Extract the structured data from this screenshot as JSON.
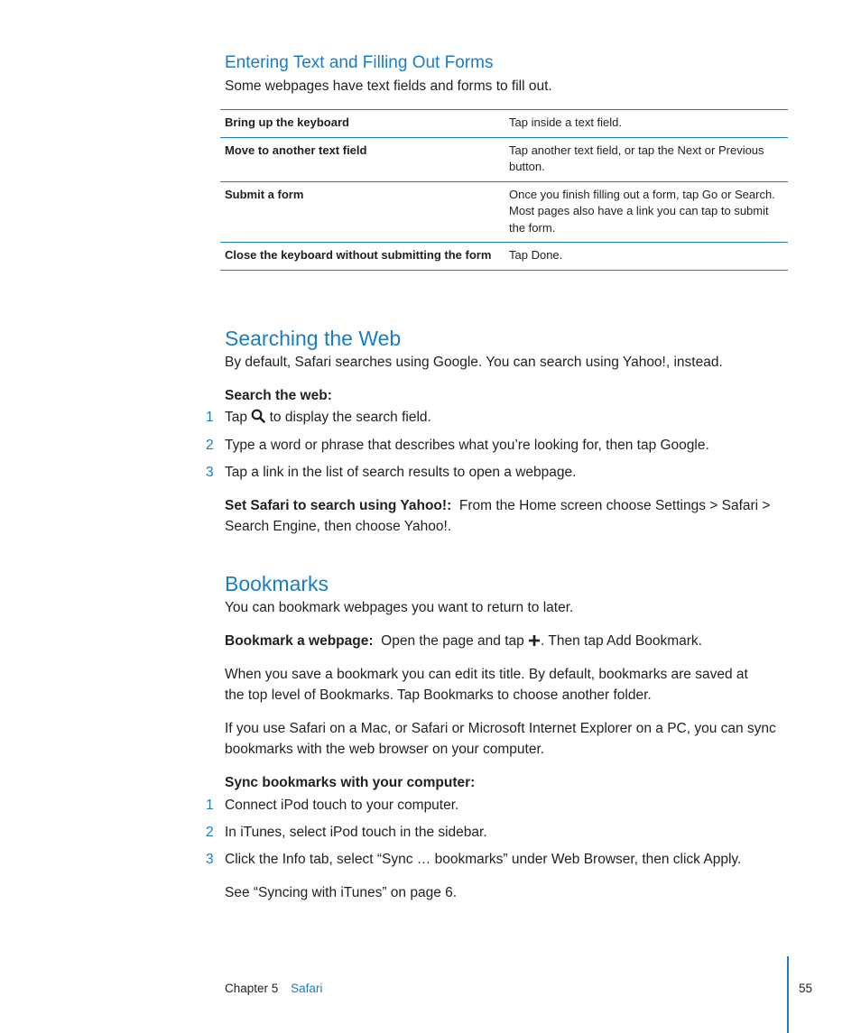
{
  "section_forms": {
    "title": "Entering Text and Filling Out Forms",
    "intro": "Some webpages have text fields and forms to fill out.",
    "table": [
      {
        "action": "Bring up the keyboard",
        "how": "Tap inside a text field."
      },
      {
        "action": "Move to another text field",
        "how": "Tap another text field, or tap the Next or Previous button."
      },
      {
        "action": "Submit a form",
        "how": "Once you finish filling out a form, tap Go or Search. Most pages also have a link you can tap to submit the form."
      },
      {
        "action": "Close the keyboard without submitting the form",
        "how": "Tap Done."
      }
    ]
  },
  "section_search": {
    "title": "Searching the Web",
    "intro": "By default, Safari searches using Google. You can search using Yahoo!, instead.",
    "steps_label": "Search the web:",
    "steps": [
      {
        "num": "1",
        "before": "Tap ",
        "icon": "search-icon",
        "after": " to display the search field."
      },
      {
        "num": "2",
        "text": "Type a word or phrase that describes what you’re looking for, then tap Google."
      },
      {
        "num": "3",
        "text": "Tap a link in the list of search results to open a webpage."
      }
    ],
    "yahoo_label": "Set Safari to search using Yahoo!:",
    "yahoo_text_line1": "From the Home screen choose Settings > Safari >",
    "yahoo_text_line2": "Search Engine, then choose Yahoo!."
  },
  "section_bookmarks": {
    "title": "Bookmarks",
    "intro": "You can bookmark webpages you want to return to later.",
    "bookmark_label": "Bookmark a webpage:",
    "bookmark_before": "Open the page and tap ",
    "bookmark_icon": "plus-icon",
    "bookmark_after": ". Then tap Add Bookmark.",
    "para1_line1": "When you save a bookmark you can edit its title. By default, bookmarks are saved at",
    "para1_line2": "the top level of Bookmarks. Tap Bookmarks to choose another folder.",
    "para2_line1": "If you use Safari on a Mac, or Safari or Microsoft Internet Explorer on a PC, you can sync",
    "para2_line2": "bookmarks with the web browser on your computer.",
    "steps_label": "Sync bookmarks with your computer:",
    "steps": [
      {
        "num": "1",
        "text": "Connect iPod touch to your computer."
      },
      {
        "num": "2",
        "text": "In iTunes, select iPod touch in the sidebar."
      },
      {
        "num": "3",
        "text": "Click the Info tab, select “Sync … bookmarks” under Web Browser, then click Apply."
      }
    ],
    "see_also": "See “Syncing with iTunes” on page 6."
  },
  "footer": {
    "chapter": "Chapter 5",
    "chapter_name": "Safari",
    "page_number": "55"
  },
  "colors": {
    "accent": "#1a7cc7",
    "text": "#231f20"
  }
}
